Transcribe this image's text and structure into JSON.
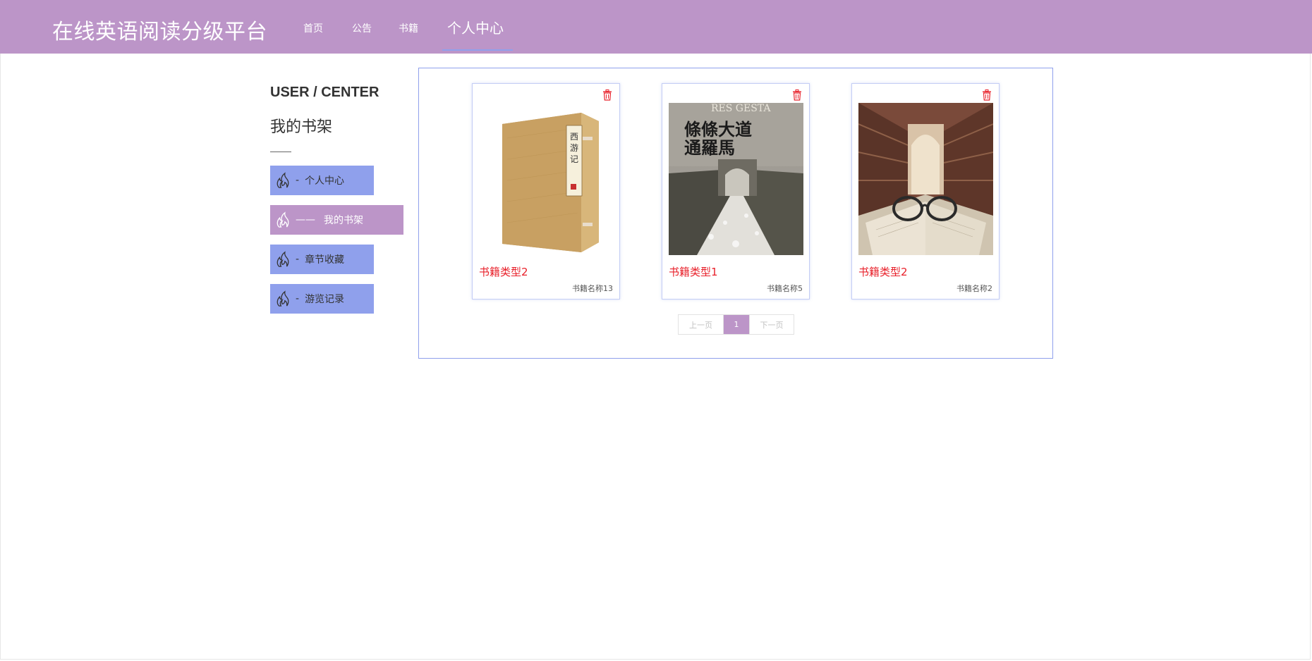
{
  "header": {
    "site_title": "在线英语阅读分级平台",
    "nav": [
      {
        "label": "首页"
      },
      {
        "label": "公告"
      },
      {
        "label": "书籍"
      },
      {
        "label": "个人中心",
        "active": true
      }
    ]
  },
  "sidebar": {
    "title_en": "USER / CENTER",
    "title_cn": "我的书架",
    "items": [
      {
        "label": "个人中心",
        "dash": "-"
      },
      {
        "label": "我的书架",
        "dash": "——",
        "active": true
      },
      {
        "label": "章节收藏",
        "dash": "-"
      },
      {
        "label": "游览记录",
        "dash": "-"
      }
    ]
  },
  "books": [
    {
      "type": "书籍类型2",
      "name": "书籍名称13",
      "cover_icon": "boxed-book-xiyouji-cover"
    },
    {
      "type": "书籍类型1",
      "name": "书籍名称5",
      "cover_icon": "roman-road-book-cover"
    },
    {
      "type": "书籍类型2",
      "name": "书籍名称2",
      "cover_icon": "library-glasses-cover"
    }
  ],
  "cover_texts": {
    "xiyouji": "西游记",
    "roman_title_1": "條條大道",
    "roman_title_2": "通羅馬"
  },
  "pagination": {
    "prev": "上一页",
    "current": "1",
    "next": "下一页"
  },
  "colors": {
    "brand": "#bc95c8",
    "accent": "#8fa0ec",
    "type_text": "#e8202a"
  }
}
